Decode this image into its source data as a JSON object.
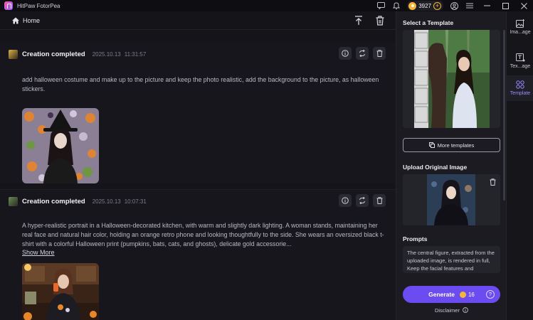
{
  "app": {
    "title": "HitPaw FotorPea"
  },
  "titlebar": {
    "coins": "3927"
  },
  "nav": {
    "home_label": "Home"
  },
  "feed": [
    {
      "title": "Creation completed",
      "date": "2025.10.13",
      "time": "11:31:57",
      "prompt": "add halloween costume and make up to the picture and keep the photo realistic, add the background to the picture, as halloween stickers."
    },
    {
      "title": "Creation completed",
      "date": "2025.10.13",
      "time": "10:07:31",
      "prompt": "A hyper-realistic portrait in a Halloween-decorated kitchen, with warm and slightly dark lighting. A woman stands, maintaining her real face and natural hair color, holding an orange retro phone and looking thoughtfully to the side. She wears an oversized black t-shirt with a colorful Halloween print (pumpkins, bats, cats, and ghosts), delicate gold accessorie...",
      "show_more": "Show More"
    }
  ],
  "panel": {
    "select_template": "Select a Template",
    "more_templates": "More templates",
    "upload_heading": "Upload Original Image",
    "prompts_heading": "Prompts",
    "prompt_text": "The central figure, extracted from the uploaded image, is rendered in full, Keep the facial features and",
    "generate_label": "Generate",
    "generate_cost": "16",
    "disclaimer": "Disclaimer"
  },
  "rail": [
    {
      "label": "Ima...age"
    },
    {
      "label": "Tex...age"
    },
    {
      "label": "Template"
    }
  ],
  "colors": {
    "accent": "#6b4cf0",
    "coin": "#f4b73a",
    "background": "#141419"
  }
}
